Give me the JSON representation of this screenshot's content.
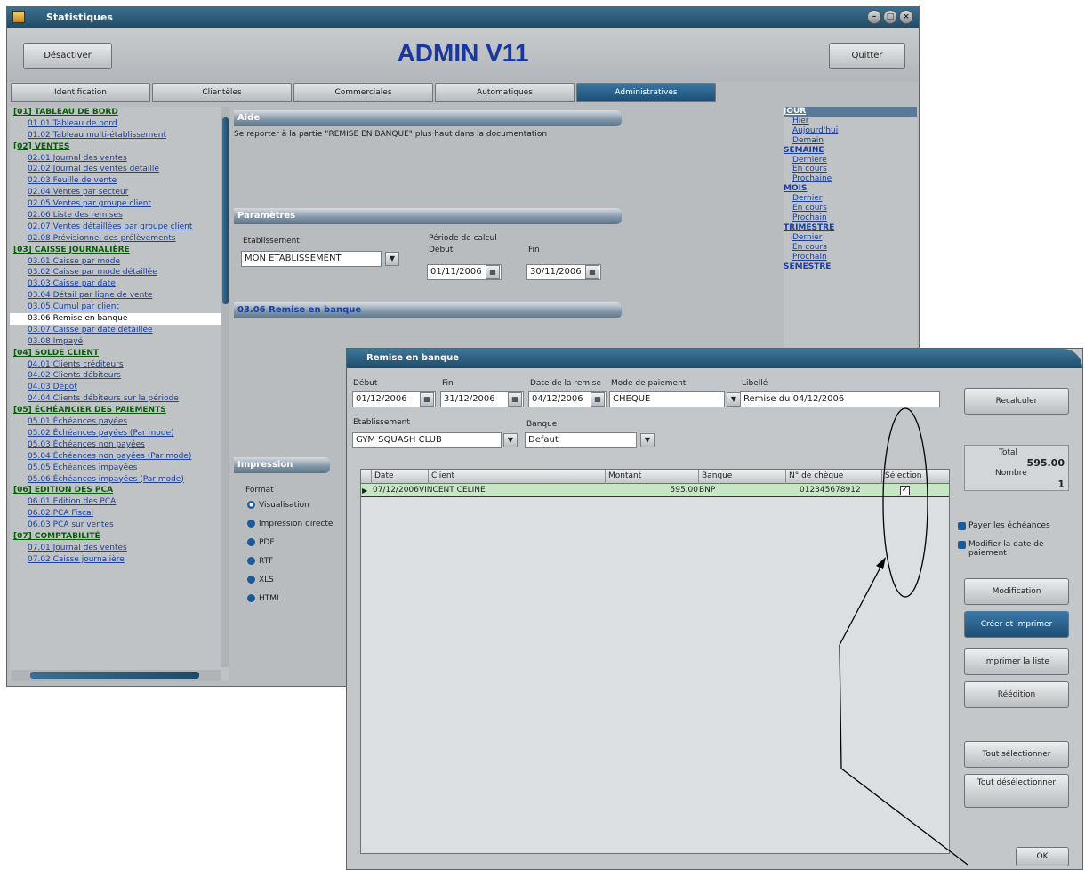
{
  "back_window": {
    "title": "Statistiques",
    "app_title": "ADMIN V11",
    "deactivate_label": "Désactiver",
    "quit_label": "Quitter",
    "tabs": [
      "Identification",
      "Clientèles",
      "Commerciales",
      "Automatiques",
      "Administratives"
    ],
    "active_tab": "Administratives",
    "sidebar_items": [
      {
        "label": "[01] TABLEAU DE BORD",
        "cat": true
      },
      {
        "label": "01.01 Tableau de bord"
      },
      {
        "label": "01.02 Tableau multi-établissement"
      },
      {
        "label": "[02] VENTES",
        "cat": true
      },
      {
        "label": "02.01 Journal des ventes"
      },
      {
        "label": "02.02 Journal des ventes détaillé"
      },
      {
        "label": "02.03 Feuille de vente"
      },
      {
        "label": "02.04 Ventes par secteur"
      },
      {
        "label": "02.05 Ventes par groupe client"
      },
      {
        "label": "02.06 Liste des remises"
      },
      {
        "label": "02.07 Ventes détaillées par groupe client"
      },
      {
        "label": "02.08 Prévisionnel des prélèvements"
      },
      {
        "label": "[03] CAISSE JOURNALIÈRE",
        "cat": true
      },
      {
        "label": "03.01 Caisse par mode"
      },
      {
        "label": "03.02 Caisse par mode détaillée"
      },
      {
        "label": "03.03 Caisse par date"
      },
      {
        "label": "03.04 Détail par ligne de vente"
      },
      {
        "label": "03.05 Cumul par client"
      },
      {
        "label": "03.06 Remise en banque",
        "sel": true
      },
      {
        "label": "03.07 Caisse par date détaillée"
      },
      {
        "label": "03.08 Impayé"
      },
      {
        "label": "[04] SOLDE CLIENT",
        "cat": true
      },
      {
        "label": "04.01 Clients créditeurs"
      },
      {
        "label": "04.02 Clients débiteurs"
      },
      {
        "label": "04.03 Dépôt"
      },
      {
        "label": "04.04 Clients débiteurs sur la période"
      },
      {
        "label": "[05] ÉCHÉANCIER DES PAIEMENTS",
        "cat": true
      },
      {
        "label": "05.01 Échéances payées"
      },
      {
        "label": "05.02 Échéances payées (Par mode)"
      },
      {
        "label": "05.03 Échéances non payées"
      },
      {
        "label": "05.04 Échéances non payées (Par mode)"
      },
      {
        "label": "05.05 Échéances impayées"
      },
      {
        "label": "05.06 Échéances impayées (Par mode)"
      },
      {
        "label": "[06] EDITION DES PCA",
        "cat": true
      },
      {
        "label": "06.01 Edition des PCA"
      },
      {
        "label": "06.02 PCA Fiscal"
      },
      {
        "label": "06.03 PCA sur ventes"
      },
      {
        "label": "[07] COMPTABILITÉ",
        "cat": true
      },
      {
        "label": "07.01 Journal des ventes"
      },
      {
        "label": "07.02 Caisse journalière"
      }
    ],
    "aide_title": "Aide",
    "aide_text": "Se reporter à la partie \"REMISE EN BANQUE\" plus haut dans la documentation",
    "params_title": "Paramètres",
    "etab_label": "Etablissement",
    "etab_value": "MON ETABLISSEMENT",
    "periode_label": "Période de calcul",
    "debut_label": "Début",
    "fin_label": "Fin",
    "debut_value": "01/11/2006",
    "fin_value": "30/11/2006",
    "report_title": "03.06 Remise en banque",
    "impression_title": "Impression",
    "format_label": "Format",
    "formats": [
      "Visualisation",
      "Impression directe",
      "PDF",
      "RTF",
      "XLS",
      "HTML"
    ],
    "quick": [
      {
        "label": "JOUR",
        "h": true,
        "sel": true
      },
      {
        "label": "Hier"
      },
      {
        "label": "Aujourd'hui"
      },
      {
        "label": "Demain"
      },
      {
        "label": "SEMAINE",
        "h": true
      },
      {
        "label": "Dernière"
      },
      {
        "label": "En cours"
      },
      {
        "label": "Prochaine"
      },
      {
        "label": "MOIS",
        "h": true
      },
      {
        "label": "Dernier"
      },
      {
        "label": "En cours"
      },
      {
        "label": "Prochain"
      },
      {
        "label": "TRIMESTRE",
        "h": true
      },
      {
        "label": "Dernier"
      },
      {
        "label": "En cours"
      },
      {
        "label": "Prochain"
      },
      {
        "label": "SEMESTRE",
        "h": true
      }
    ]
  },
  "dialog": {
    "title": "Remise en banque",
    "debut_label": "Début",
    "debut_value": "01/12/2006",
    "fin_label": "Fin",
    "fin_value": "31/12/2006",
    "date_remise_label": "Date de la remise",
    "date_remise_value": "04/12/2006",
    "mode_label": "Mode de paiement",
    "mode_value": "CHEQUE",
    "libelle_label": "Libellé",
    "libelle_value": "Remise du 04/12/2006",
    "etab_label": "Etablissement",
    "etab_value": "GYM SQUASH CLUB",
    "banque_label": "Banque",
    "banque_value": "Defaut",
    "recalculer": "Recalculer",
    "total_label": "Total",
    "total_value": "595.00",
    "nombre_label": "Nombre",
    "nombre_value": "1",
    "columns": [
      "Date",
      "Client",
      "Montant",
      "Banque",
      "N° de chèque",
      "Sélection"
    ],
    "rows": [
      {
        "date": "07/12/2006",
        "client": "VINCENT CELINE",
        "montant": "595.00",
        "banque": "BNP",
        "cheque": "012345678912",
        "selection": true
      }
    ],
    "payer_echeances": "Payer les échéances",
    "modifier_date": "Modifier la date de paiement",
    "btn_modification": "Modification",
    "btn_creer": "Créer et imprimer",
    "btn_imprimer": "Imprimer la liste",
    "btn_reedition": "Réédition",
    "btn_tout_sel": "Tout sélectionner",
    "btn_tout_desel": "Tout désélectionner",
    "btn_ok": "OK"
  }
}
